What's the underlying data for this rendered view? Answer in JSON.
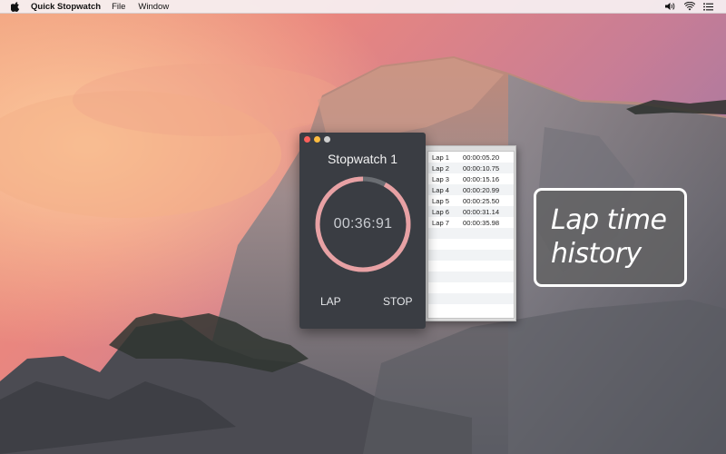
{
  "menubar": {
    "apple_icon": "apple-logo-icon",
    "app_name": "Quick Stopwatch",
    "menus": [
      "File",
      "Window"
    ],
    "status_icons": [
      "volume-icon",
      "wifi-icon",
      "list-icon"
    ]
  },
  "stopwatch": {
    "title": "Stopwatch 1",
    "elapsed": "00:36:91",
    "lap_label": "LAP",
    "stop_label": "STOP",
    "ring_progress": 0.92,
    "colors": {
      "ring": "#e8a1a4",
      "track": "#6a6d72",
      "background": "#3a3d43"
    }
  },
  "laps": [
    {
      "label": "Lap 1",
      "time": "00:00:05.20"
    },
    {
      "label": "Lap 2",
      "time": "00:00:10.75"
    },
    {
      "label": "Lap 3",
      "time": "00:00:15.16"
    },
    {
      "label": "Lap 4",
      "time": "00:00:20.99"
    },
    {
      "label": "Lap 5",
      "time": "00:00:25.50"
    },
    {
      "label": "Lap 6",
      "time": "00:00:31.14"
    },
    {
      "label": "Lap 7",
      "time": "00:00:35.98"
    }
  ],
  "callout": {
    "line1": "Lap time",
    "line2": "history"
  }
}
